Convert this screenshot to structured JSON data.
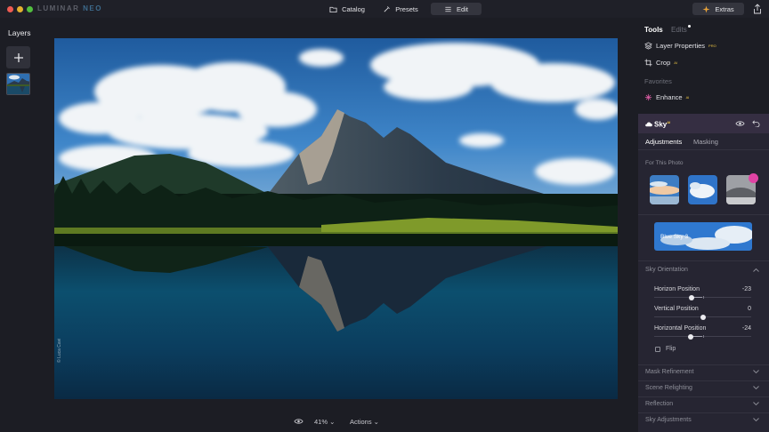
{
  "window": {
    "brand_prefix": "LUMINAR",
    "brand_suffix": "NEO"
  },
  "modes": {
    "catalog": "Catalog",
    "presets": "Presets",
    "edit": "Edit",
    "active": "Edit"
  },
  "extras_label": "Extras",
  "layers": {
    "title": "Layers"
  },
  "canvas": {
    "photo_credit": "© Luca Cavi"
  },
  "bottom_bar": {
    "zoom": "41% ⌄",
    "actions": "Actions ⌄"
  },
  "right_panel": {
    "tab_tools": "Tools",
    "tab_edits": "Edits",
    "layer_properties": "Layer Properties",
    "layer_properties_badge": "PRO",
    "crop": "Crop",
    "crop_badge": "AI",
    "favorites_label": "Favorites",
    "enhance": "Enhance",
    "enhance_badge": "AI"
  },
  "sky_tool": {
    "title": "Sky",
    "title_badge": "AI",
    "subtab_adjustments": "Adjustments",
    "subtab_masking": "Masking",
    "for_this_photo": "For This Photo",
    "selected_sky": "Blue Sky 3",
    "orientation": {
      "title": "Sky Orientation",
      "sliders": [
        {
          "label": "Horizon Position",
          "value": "-23",
          "numeric": -23
        },
        {
          "label": "Vertical Position",
          "value": "0",
          "numeric": 0
        },
        {
          "label": "Horizontal Position",
          "value": "-24",
          "numeric": -24
        }
      ],
      "flip": "Flip"
    },
    "collapsed_sections": [
      "Mask Refinement",
      "Scene Relighting",
      "Reflection",
      "Sky Adjustments"
    ]
  },
  "colors": {
    "accent_pink": "#e043a4",
    "sky_panel": "#262532",
    "badge_gold": "#e9c243"
  }
}
